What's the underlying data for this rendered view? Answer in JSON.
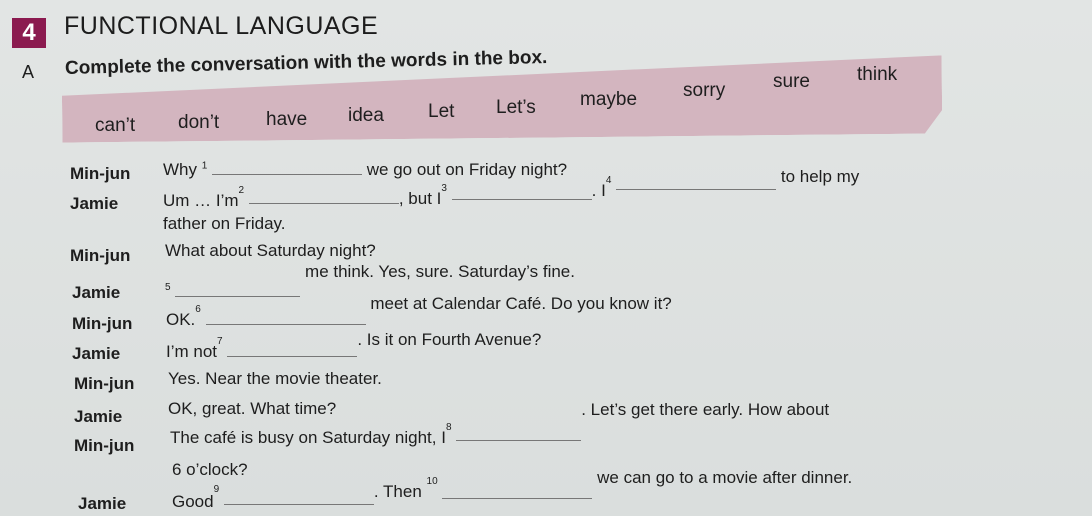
{
  "section": {
    "number": "4",
    "title": "FUNCTIONAL LANGUAGE"
  },
  "exercise": {
    "letter": "A",
    "instruction": "Complete the conversation with the words in the box."
  },
  "word_box": [
    "can’t",
    "don’t",
    "have",
    "idea",
    "Let",
    "Let’s",
    "maybe",
    "sorry",
    "sure",
    "think"
  ],
  "dialogue": [
    {
      "speaker": "Min-jun",
      "pre": "Why",
      "num": "1",
      "post": "we go out on Friday night?"
    },
    {
      "speaker": "Jamie",
      "pre": "Um … I’m",
      "num": "2",
      "mid": ", but I",
      "num2": "3",
      "mid2": ". I",
      "num3": "4",
      "post": "to help my",
      "cont": "father on Friday."
    },
    {
      "speaker": "Min-jun",
      "text": "What about Saturday night?"
    },
    {
      "speaker": "Jamie",
      "num": "5",
      "post": "me think. Yes, sure. Saturday’s fine."
    },
    {
      "speaker": "Min-jun",
      "pre": "OK.",
      "num": "6",
      "post": "meet at Calendar Café. Do you know it?"
    },
    {
      "speaker": "Jamie",
      "pre": "I’m not",
      "num": "7",
      "post": ". Is it on Fourth Avenue?"
    },
    {
      "speaker": "Min-jun",
      "text": "Yes. Near the movie theater."
    },
    {
      "speaker": "Jamie",
      "text": "OK, great. What time?"
    },
    {
      "speaker": "Min-jun",
      "pre": "The café is busy on Saturday night, I",
      "num": "8",
      "post": ". Let’s get there early. How about",
      "cont": "6 o’clock?"
    },
    {
      "speaker": "Jamie",
      "pre": "Good",
      "num": "9",
      "mid": ". Then",
      "num2": "10",
      "post": "we can go to a movie after dinner."
    }
  ]
}
